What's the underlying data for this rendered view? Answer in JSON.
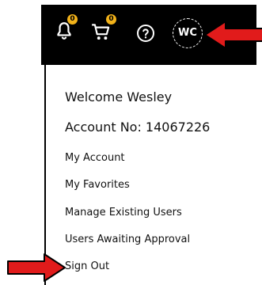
{
  "header": {
    "notifications_badge": "0",
    "cart_badge": "0",
    "avatar_initials": "WC"
  },
  "menu": {
    "welcome": "Welcome Wesley",
    "account_no": "Account No: 14067226",
    "items": [
      {
        "label": "My Account"
      },
      {
        "label": "My Favorites"
      },
      {
        "label": "Manage Existing Users"
      },
      {
        "label": "Users Awaiting Approval"
      },
      {
        "label": "Sign Out"
      }
    ]
  },
  "colors": {
    "topbar": "#000000",
    "badge": "#f2b21a",
    "annotation_arrow": "#e11b1b"
  },
  "icons": [
    "bell-icon",
    "cart-icon",
    "help-icon"
  ]
}
